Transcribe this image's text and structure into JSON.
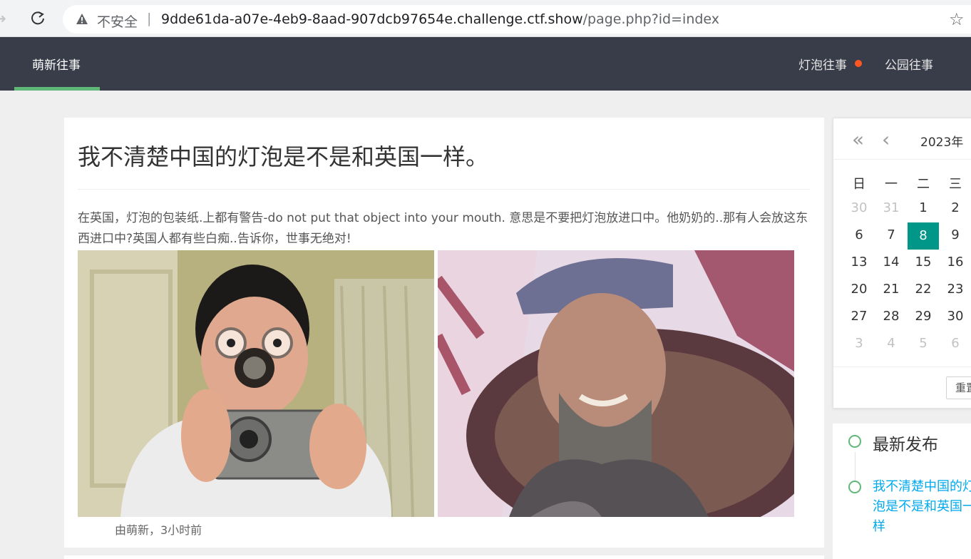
{
  "browser": {
    "security_label": "不安全",
    "separator": "|",
    "url_host": "9dde61da-a07e-4eb9-8aad-907dcb97654e.challenge.ctf.show",
    "url_path": "/page.php?id=index"
  },
  "header": {
    "brand": "萌新往事",
    "nav": [
      "灯泡往事",
      "公园往事"
    ],
    "colors": {
      "bg": "#393d49",
      "active_underline": "#5fb878",
      "dot": "#ff5722"
    }
  },
  "article": {
    "title": "我不清楚中国的灯泡是不是和英国一样。",
    "body": "在英国，灯泡的包装纸.上都有警告-do not put that object into your mouth. 意思是不要把灯泡放进口中。他奶奶的..那有人会放这东西进口中?英国人都有些白痴..告诉你，世事无绝对!",
    "meta": "由萌新，3小时前"
  },
  "calendar": {
    "year_label": "2023年",
    "weekdays": [
      "日",
      "一",
      "二",
      "三"
    ],
    "weeks": [
      [
        "30",
        "31",
        "1",
        "2"
      ],
      [
        "6",
        "7",
        "8",
        "9"
      ],
      [
        "13",
        "14",
        "15",
        "16"
      ],
      [
        "20",
        "21",
        "22",
        "23"
      ],
      [
        "27",
        "28",
        "29",
        "30"
      ],
      [
        "3",
        "4",
        "5",
        "6"
      ]
    ],
    "selected_day": "8",
    "reset_label": "重置",
    "selected_color": "#009688"
  },
  "latest": {
    "title": "最新发布",
    "link": "我不清楚中国的灯泡是不是和英国一样"
  }
}
